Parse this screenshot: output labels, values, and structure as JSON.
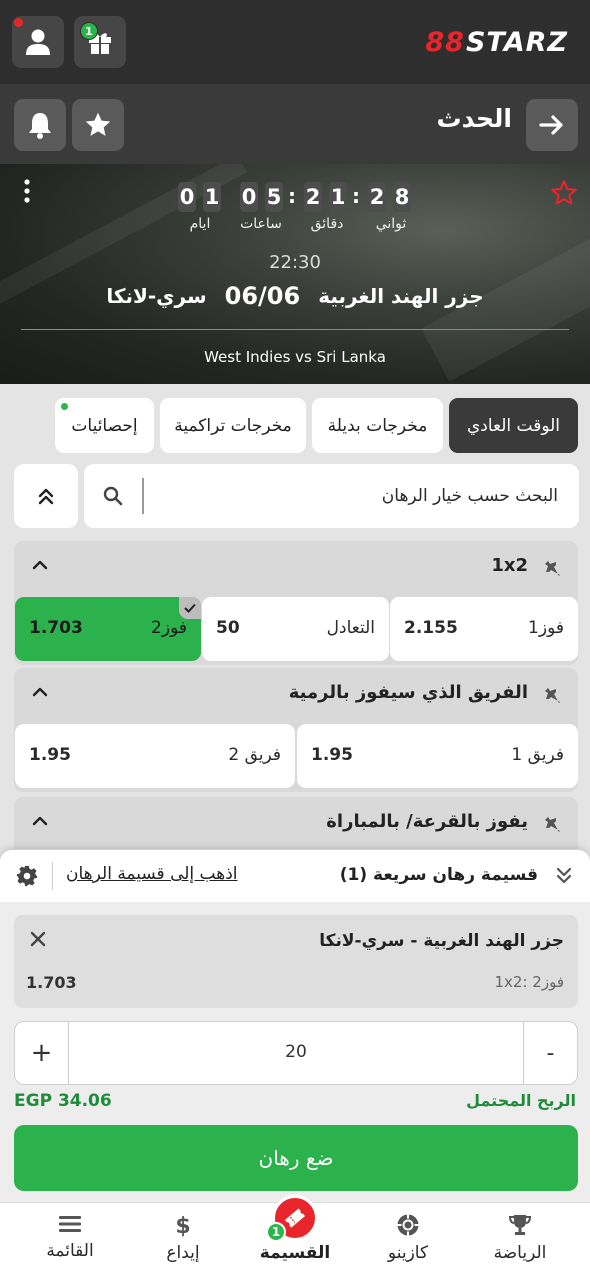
{
  "header": {
    "logo_mark": "88",
    "logo_text": "STARZ",
    "gift_badge": "1"
  },
  "titlebar": {
    "title": "الحدث"
  },
  "event": {
    "countdown": {
      "days": [
        "0",
        "1"
      ],
      "hours": [
        "0",
        "5"
      ],
      "minutes": [
        "2",
        "1"
      ],
      "seconds": [
        "2",
        "8"
      ],
      "days_label": "ايام",
      "hours_label": "ساعات",
      "minutes_label": "دقائق",
      "seconds_label": "ثواني"
    },
    "time": "22:30",
    "team_home": "جزر الهند الغربية",
    "date": "06/06",
    "team_away": "سري-لانكا",
    "subtitle": "West Indies vs Sri Lanka"
  },
  "tabs": [
    {
      "label": "الوقت العادي",
      "active": true
    },
    {
      "label": "مخرجات بديلة",
      "active": false
    },
    {
      "label": "مخرجات تراكمية",
      "active": false
    },
    {
      "label": "إحصائيات",
      "active": false
    }
  ],
  "search": {
    "placeholder": "البحث حسب خيار الرهان"
  },
  "markets": [
    {
      "title": "1x2",
      "outcomes": [
        {
          "label": "فوز1",
          "odds": "2.155",
          "selected": false
        },
        {
          "label": "التعادل",
          "odds": "50",
          "selected": false
        },
        {
          "label": "فوز2",
          "odds": "1.703",
          "selected": true
        }
      ]
    },
    {
      "title": "الفريق الذي سيفوز بالرمية",
      "outcomes": [
        {
          "label": "فريق 1",
          "odds": "1.95",
          "selected": false
        },
        {
          "label": "فريق 2",
          "odds": "1.95",
          "selected": false
        }
      ]
    },
    {
      "title": "يفوز بالقرعة/ بالمباراة",
      "outcomes": []
    }
  ],
  "betslip": {
    "title": "قسيمة رهان سريعة (1)",
    "goto_label": "اذهب إلى قسيمة الرهان",
    "bet": {
      "match": "جزر الهند الغربية - سري-لانكا",
      "market": "1x2: فوز2",
      "odds": "1.703"
    },
    "stake": "20",
    "minus_label": "-",
    "plus_label": "+",
    "potential_win_label": "الربح المحتمل",
    "potential_win_value": "EGP 34.06",
    "place_bet_label": "ضع رهان"
  },
  "bottom_nav": {
    "sports": "الرياضة",
    "casino": "كازينو",
    "betslip": "القسيمة",
    "betslip_badge": "1",
    "deposit": "إيداع",
    "menu": "القائمة"
  },
  "colors": {
    "accent_green": "#2bb24c",
    "brand_red": "#e8252a",
    "dark_bar": "#2e2e2e"
  }
}
